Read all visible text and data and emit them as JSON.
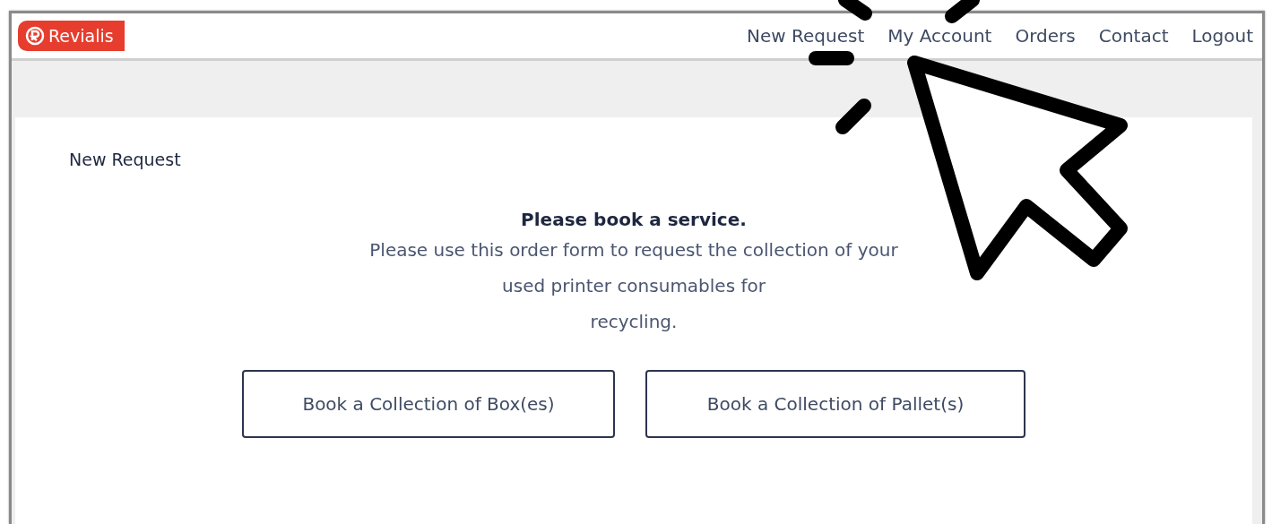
{
  "logo": {
    "text": "Revialis"
  },
  "nav": [
    {
      "label": "New Request"
    },
    {
      "label": "My Account"
    },
    {
      "label": "Orders"
    },
    {
      "label": "Contact"
    },
    {
      "label": "Logout"
    }
  ],
  "page_title": "New Request",
  "heading": "Please book a service.",
  "intro_lines": [
    "Please use this order form to request the collection of your",
    "used printer consumables for",
    "recycling."
  ],
  "buttons": [
    {
      "label": "Book a Collection of Box(es)"
    },
    {
      "label": "Book a Collection of Pallet(s)"
    }
  ]
}
